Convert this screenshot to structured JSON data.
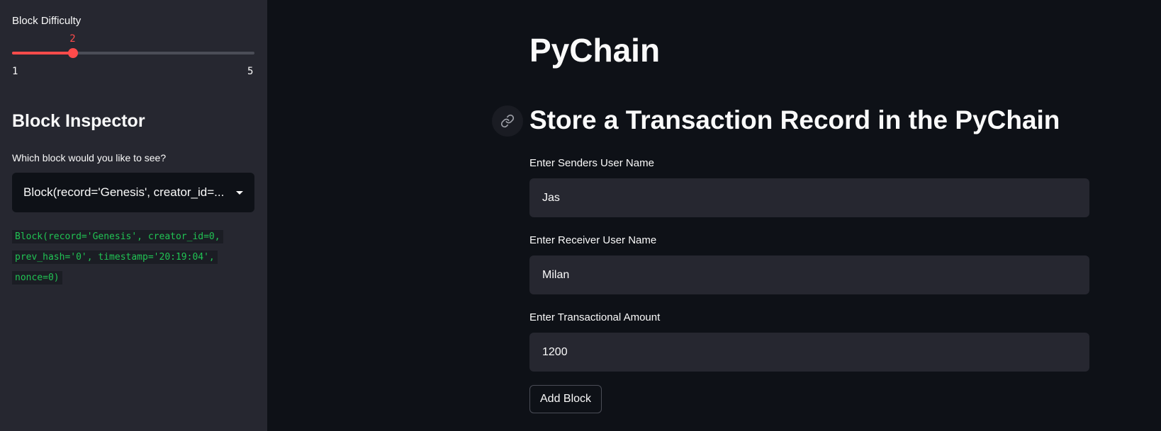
{
  "sidebar": {
    "slider": {
      "label": "Block Difficulty",
      "value": "2",
      "min": "1",
      "max": "5",
      "accent_color": "#ff4b4b"
    },
    "inspector_title": "Block Inspector",
    "select_label": "Which block would you like to see?",
    "select_value": "Block(record='Genesis', creator_id=...",
    "code_lines": [
      "Block(record='Genesis', creator_id=0,",
      "prev_hash='0', timestamp='20:19:04',",
      "nonce=0)"
    ]
  },
  "main": {
    "title": "PyChain",
    "section_title": "Store a Transaction Record in the PyChain",
    "fields": [
      {
        "label": "Enter Senders User Name",
        "value": "Jas"
      },
      {
        "label": "Enter Receiver User Name",
        "value": "Milan"
      },
      {
        "label": "Enter Transactional Amount",
        "value": "1200"
      }
    ],
    "button_label": "Add Block"
  }
}
